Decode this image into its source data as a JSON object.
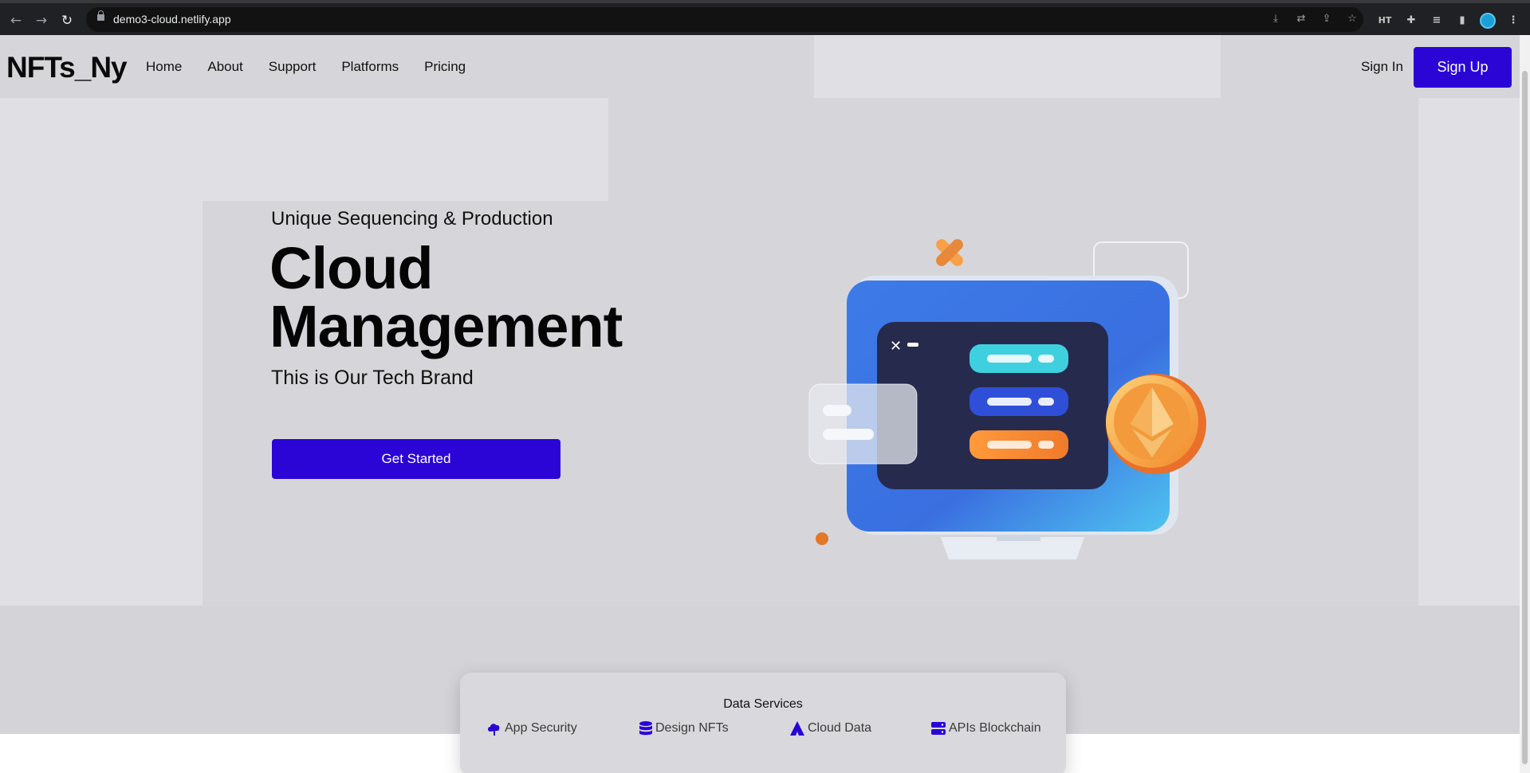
{
  "browser": {
    "url": "demo3-cloud.netlify.app",
    "extension_label": "HT"
  },
  "header": {
    "brand": "NFTs_Ny",
    "nav": [
      "Home",
      "About",
      "Support",
      "Platforms",
      "Pricing"
    ],
    "sign_in": "Sign In",
    "sign_up": "Sign Up"
  },
  "hero": {
    "eyebrow": "Unique Sequencing & Production",
    "title_line1": "Cloud",
    "title_line2": "Management",
    "tagline": "This is Our Tech Brand",
    "cta": "Get Started"
  },
  "services": {
    "title": "Data Services",
    "items": [
      {
        "label": "App Security",
        "icon": "cloud-upload-icon"
      },
      {
        "label": "Design NFTs",
        "icon": "database-icon"
      },
      {
        "label": "Cloud Data",
        "icon": "triangle-icon"
      },
      {
        "label": "APIs Blockchain",
        "icon": "server-icon"
      }
    ]
  },
  "colors": {
    "accent": "#2a05d6",
    "page_bg": "#d6d6da",
    "text": "#0a0a0a"
  }
}
